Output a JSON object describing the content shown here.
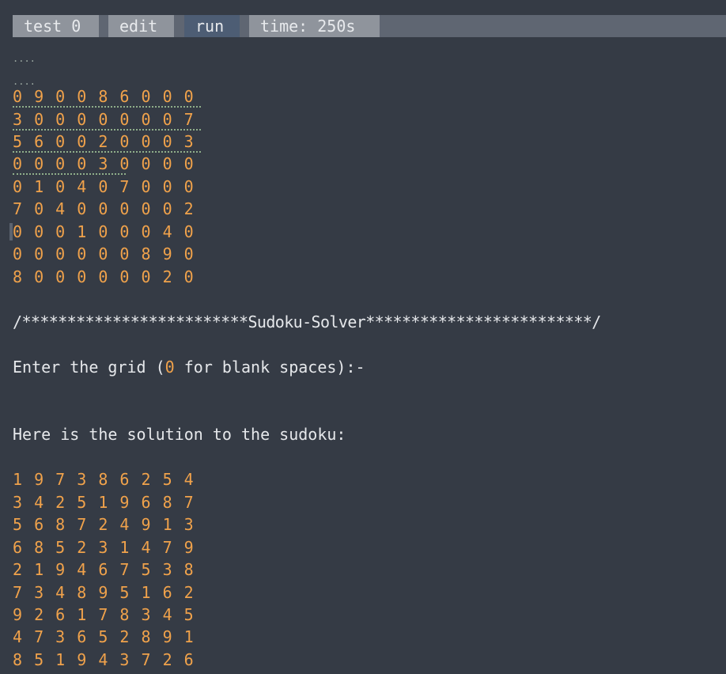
{
  "tabs": {
    "test": "test 0",
    "edit": "edit",
    "run": "run",
    "time": "time: 250s"
  },
  "ellipsis": [
    "....",
    "...."
  ],
  "input_grid": [
    "0 9 0 0 8 6 0 0 0",
    "3 0 0 0 0 0 0 0 7",
    "5 6 0 0 2 0 0 0 3",
    "0 0 0 0 3 0 0 0 0",
    "0 1 0 4 0 7 0 0 0",
    "7 0 4 0 0 0 0 0 2",
    "0 0 0 1 0 0 0 4 0",
    "0 0 0 0 0 0 8 9 0",
    "8 0 0 0 0 0 0 2 0"
  ],
  "banner": "/*************************Sudoku-Solver*************************/",
  "prompt": {
    "before": "Enter the grid (",
    "zero": "0",
    "after": " for blank spaces):-"
  },
  "solution_heading": "Here is the solution to the sudoku:",
  "solution_grid": [
    "1 9 7 3 8 6 2 5 4",
    "3 4 2 5 1 9 6 8 7",
    "5 6 8 7 2 4 9 1 3",
    "6 8 5 2 3 1 4 7 9",
    "2 1 9 4 6 7 5 3 8",
    "7 3 4 8 9 5 1 6 2",
    "9 2 6 1 7 8 3 4 5",
    "4 7 3 6 5 2 8 9 1",
    "8 5 1 9 4 3 7 2 6"
  ]
}
